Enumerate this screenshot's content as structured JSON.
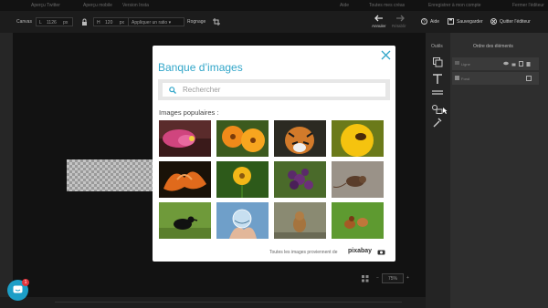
{
  "top_strip": {
    "items": [
      "Aperçu Twitter",
      "Aperçu mobile",
      "Version Insta",
      "Aide",
      "Toutes mes créas",
      "Enregistrer à mon compte",
      "Fermer l'éditeur"
    ]
  },
  "toolbar": {
    "canvas_label": "Canvas",
    "width_label": "L",
    "width_value": "1126",
    "width_unit": "px",
    "height_label": "H",
    "height_value": "120",
    "height_unit": "px",
    "ratio_label": "Appliquer un ratio",
    "crop_label": "Rognage",
    "undo_label": "Annuler",
    "redo_label": "Rétablir",
    "help_label": "Aide",
    "save_label": "Sauvegarder",
    "quit_label": "Quitter l'éditeur"
  },
  "outils": {
    "title": "Outils"
  },
  "layers_panel": {
    "title": "Ordre des éléments",
    "layers": [
      {
        "label": "Ligne"
      },
      {
        "label": "Fond"
      }
    ]
  },
  "zoom": {
    "value": "75%"
  },
  "chat": {
    "badge": "1"
  },
  "modal": {
    "title": "Banque d’images",
    "search_placeholder": "Rechercher",
    "popular_label": "Images populaires :",
    "footer_text": "Toutes les images proviennent de",
    "provider_logo": "pixabay",
    "images": [
      {
        "alt": "pink flower"
      },
      {
        "alt": "orange flowers"
      },
      {
        "alt": "tiger"
      },
      {
        "alt": "bee on yellow flower"
      },
      {
        "alt": "orange lily"
      },
      {
        "alt": "yellow flower"
      },
      {
        "alt": "purple berries"
      },
      {
        "alt": "mouse"
      },
      {
        "alt": "crow"
      },
      {
        "alt": "glass ball in hand"
      },
      {
        "alt": "dog running"
      },
      {
        "alt": "puppies on grass"
      }
    ]
  },
  "colors": {
    "accent": "#32a6c9",
    "canvas_bg": "#121212",
    "panel_bg": "#2e2e2e"
  }
}
